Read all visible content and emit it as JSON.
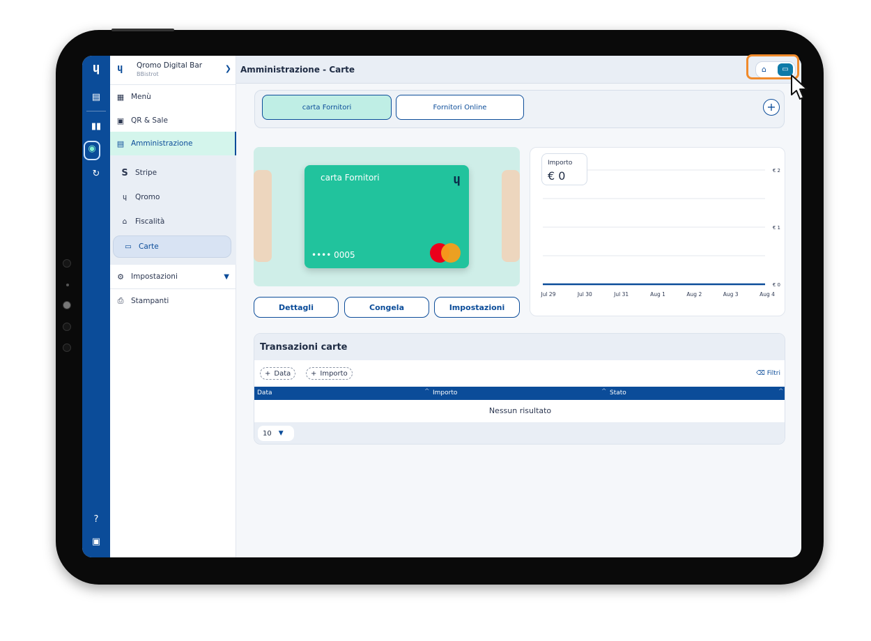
{
  "header": {
    "business_name": "Qromo Digital Bar",
    "business_sub": "BBistrot",
    "page_title": "Amministrazione - Carte"
  },
  "rail": {
    "logo": "ɥ",
    "icons": [
      "menu-book-icon",
      "stats-icon",
      "admin-icon",
      "activity-icon",
      "help-icon",
      "monitor-icon"
    ]
  },
  "sidebar": {
    "items": [
      {
        "label": "Menù",
        "icon": "▦"
      },
      {
        "label": "QR & Sale",
        "icon": "▣"
      },
      {
        "label": "Amministrazione",
        "icon": "▤"
      }
    ],
    "sub_items": [
      {
        "label": "Stripe",
        "icon": "S"
      },
      {
        "label": "Qromo",
        "icon": "ɥ"
      },
      {
        "label": "Fiscalità",
        "icon": "⌂"
      },
      {
        "label": "Carte",
        "icon": "▭"
      }
    ],
    "bottom_items": [
      {
        "label": "Impostazioni",
        "icon": "⚙"
      },
      {
        "label": "Stampanti",
        "icon": "⎙"
      }
    ]
  },
  "tabs": [
    {
      "label": "carta Fornitori"
    },
    {
      "label": "Fornitori Online"
    }
  ],
  "card": {
    "name": "carta Fornitori",
    "number": "•••• 0005",
    "logo": "ɥ",
    "color": "#21c39d"
  },
  "actions": {
    "details": "Dettagli",
    "freeze": "Congela",
    "settings": "Impostazioni"
  },
  "importo": {
    "label": "Importo",
    "value": "€ 0"
  },
  "chart_data": {
    "type": "line",
    "x": [
      "Jul 29",
      "Jul 30",
      "Jul 31",
      "Aug 1",
      "Aug 2",
      "Aug 3",
      "Aug 4"
    ],
    "series": [
      {
        "values": [
          0,
          0,
          0,
          0,
          0,
          0,
          0
        ]
      }
    ],
    "y_ticks": [
      "€ 2",
      "€ 1",
      "€ 0"
    ],
    "ylim": [
      0,
      2
    ],
    "color": "#0b4c99"
  },
  "transactions": {
    "title": "Transazioni carte",
    "filters": [
      "Data",
      "Importo"
    ],
    "filters_label": "Filtri",
    "columns": [
      "Data",
      "Importo",
      "Stato"
    ],
    "empty": "Nessun risultato",
    "page_size": "10"
  }
}
